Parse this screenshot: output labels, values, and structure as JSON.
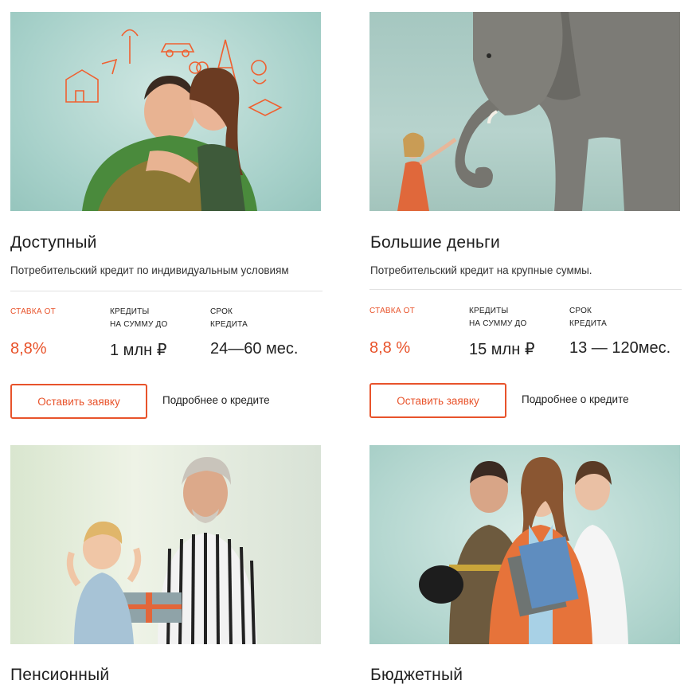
{
  "cards": [
    {
      "title": "Доступный",
      "subtitle": "Потребительский кредит по индивидуальным условиям",
      "rate_label": "Ставка от",
      "rate_value": "8,8%",
      "amount_label": "Кредиты\nна сумму до",
      "amount_value": "1 млн ₽",
      "term_label": "Срок\nкредита",
      "term_value": "24—60 мес.",
      "apply_button": "Оставить заявку",
      "more_link": "Подробнее о кредите",
      "image_desc": "couple-photo"
    },
    {
      "title": "Большие деньги",
      "subtitle": "Потребительский кредит на крупные суммы.",
      "rate_label": "Ставка от",
      "rate_value": "8,8 %",
      "amount_label": "Кредиты\nна сумму до",
      "amount_value": "15 млн ₽",
      "term_label": "Срок\nкредита",
      "term_value": "13 — 120мес.",
      "apply_button": "Оставить заявку",
      "more_link": "Подробнее о кредите",
      "image_desc": "elephant-photo"
    },
    {
      "title": "Пенсионный",
      "image_desc": "grandfather-photo"
    },
    {
      "title": "Бюджетный",
      "image_desc": "workers-photo"
    }
  ],
  "colors": {
    "accent": "#e8532b",
    "image_bg": "#a9d3cc"
  }
}
